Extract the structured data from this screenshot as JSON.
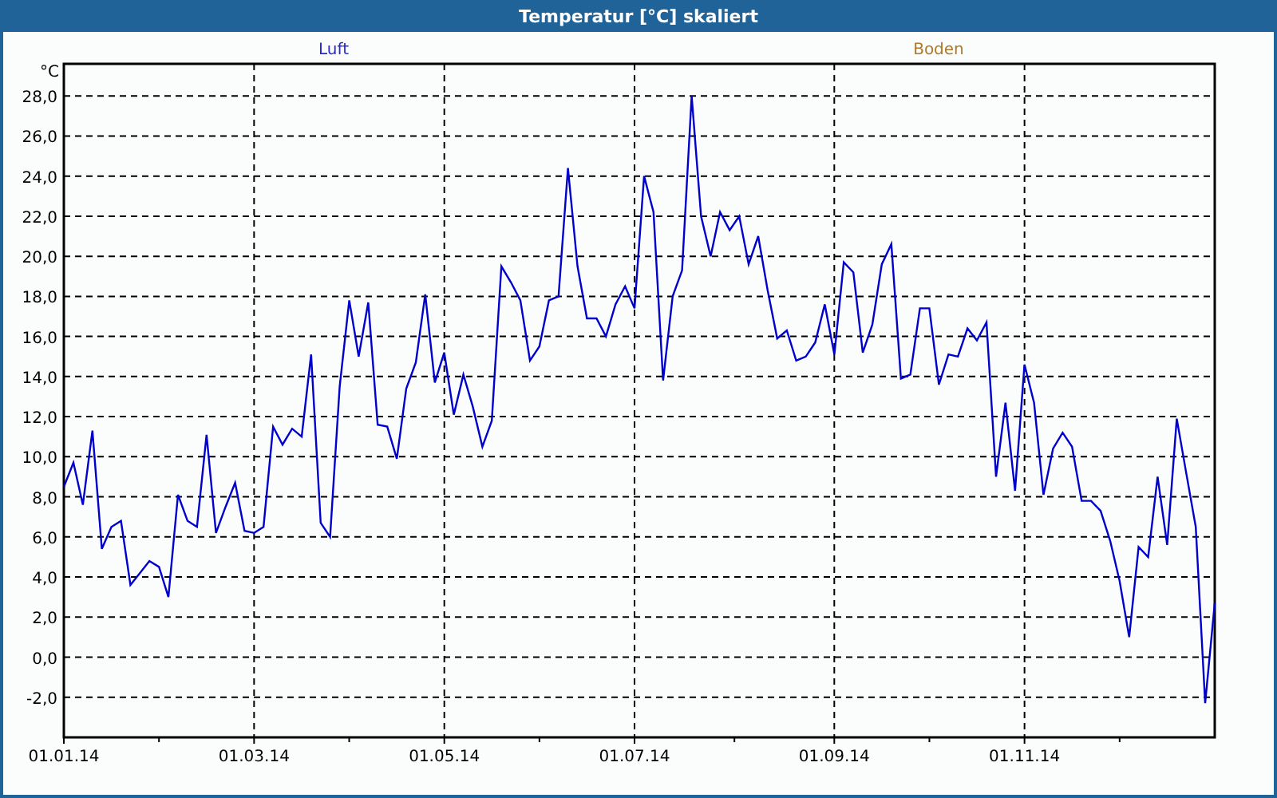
{
  "window": {
    "title": "Temperatur [°C] skaliert"
  },
  "chart": {
    "panel_labels": [
      {
        "text": "Luft",
        "color": "#2a2ad0"
      },
      {
        "text": "Boden",
        "color": "#b0782a"
      }
    ],
    "chart_data": {
      "type": "line",
      "grid": true,
      "ylabel": "°C",
      "ylim": [
        -4,
        29.6
      ],
      "yticks": [
        {
          "value": -2,
          "label": "-2,0"
        },
        {
          "value": 0,
          "label": "0,0"
        },
        {
          "value": 2,
          "label": "2,0"
        },
        {
          "value": 4,
          "label": "4,0"
        },
        {
          "value": 6,
          "label": "6,0"
        },
        {
          "value": 8,
          "label": "8,0"
        },
        {
          "value": 10,
          "label": "10,0"
        },
        {
          "value": 12,
          "label": "12,0"
        },
        {
          "value": 14,
          "label": "14,0"
        },
        {
          "value": 16,
          "label": "16,0"
        },
        {
          "value": 18,
          "label": "18,0"
        },
        {
          "value": 20,
          "label": "20,0"
        },
        {
          "value": 22,
          "label": "22,0"
        },
        {
          "value": 24,
          "label": "24,0"
        },
        {
          "value": 26,
          "label": "26,0"
        },
        {
          "value": 28,
          "label": "28,0"
        }
      ],
      "categories": [
        "01.01.14",
        null,
        null,
        null,
        null,
        null,
        null,
        null,
        null,
        null,
        null,
        null,
        null,
        null,
        null,
        null,
        null,
        null,
        null,
        null,
        "01.03.14",
        null,
        null,
        null,
        null,
        null,
        null,
        null,
        null,
        null,
        null,
        null,
        null,
        null,
        null,
        null,
        null,
        null,
        null,
        null,
        "01.05.14",
        null,
        null,
        null,
        null,
        null,
        null,
        null,
        null,
        null,
        null,
        null,
        null,
        null,
        null,
        null,
        null,
        null,
        null,
        null,
        "01.07.14",
        null,
        null,
        null,
        null,
        null,
        null,
        null,
        null,
        null,
        null,
        null,
        null,
        null,
        null,
        null,
        null,
        null,
        null,
        null,
        null,
        "01.09.14",
        null,
        null,
        null,
        null,
        null,
        null,
        null,
        null,
        null,
        null,
        null,
        null,
        null,
        null,
        null,
        null,
        null,
        null,
        null,
        "01.11.14",
        null,
        null,
        null,
        null,
        null,
        null,
        null,
        null,
        null,
        null,
        null,
        null,
        null,
        null,
        null,
        null,
        null,
        null,
        null,
        null
      ],
      "series": [
        {
          "color": "#0000cc",
          "values": [
            8.5,
            9.7,
            7.6,
            11.3,
            5.4,
            6.5,
            6.8,
            3.6,
            4.2,
            4.8,
            4.5,
            3.0,
            8.1,
            6.8,
            6.5,
            11.1,
            6.2,
            7.5,
            8.7,
            6.3,
            6.2,
            6.5,
            11.5,
            10.6,
            11.4,
            11.0,
            15.1,
            6.7,
            6.0,
            13.5,
            17.8,
            15.0,
            17.7,
            11.6,
            11.5,
            9.9,
            13.4,
            14.7,
            18.1,
            13.7,
            15.2,
            12.1,
            14.1,
            12.5,
            10.5,
            11.8,
            19.5,
            18.7,
            17.8,
            14.8,
            15.5,
            17.8,
            18.0,
            24.4,
            19.5,
            16.9,
            16.9,
            16.0,
            17.6,
            18.5,
            17.4,
            24.0,
            22.2,
            13.8,
            18.0,
            19.3,
            28.0,
            22.0,
            20.0,
            22.2,
            21.3,
            22.0,
            19.6,
            21.0,
            18.3,
            15.9,
            16.3,
            14.8,
            15.0,
            15.7,
            17.6,
            15.1,
            19.7,
            19.2,
            15.2,
            16.6,
            19.6,
            20.6,
            13.9,
            14.1,
            17.4,
            17.4,
            13.6,
            15.1,
            15.0,
            16.4,
            15.8,
            16.7,
            9.0,
            12.7,
            8.3,
            14.6,
            12.7,
            8.1,
            10.4,
            11.2,
            10.5,
            7.8,
            7.8,
            7.3,
            5.8,
            3.8,
            1.0,
            5.5,
            5.0,
            9.0,
            5.6,
            11.9,
            9.2,
            6.5,
            -2.3,
            2.7
          ]
        }
      ]
    }
  }
}
